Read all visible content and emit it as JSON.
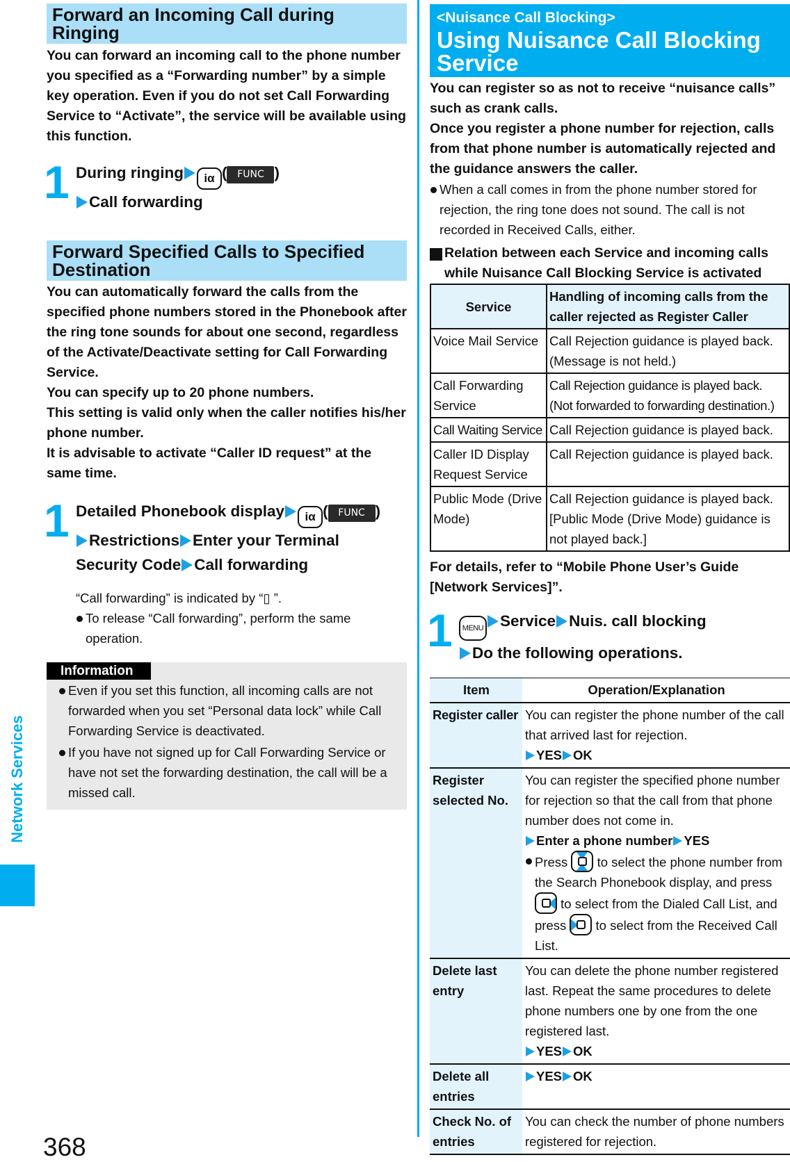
{
  "page": {
    "number": "368",
    "side_tab_label": "Network Services",
    "accent_color": "#00aeef",
    "heading_bg_color": "#aadff7"
  },
  "left": {
    "section1": {
      "title": "Forward an Incoming Call during Ringing",
      "intro": "You can forward an incoming call to the phone number you specified as a “Forwarding number” by a simple key operation. Even if you do not set Call Forwarding Service to “Activate”, the service will be available using this function.",
      "step_number": "1",
      "step_line1_text": "During ringing",
      "key_label": "iα",
      "func_label": "FUNC",
      "step_line2_text": "Call forwarding"
    },
    "section2": {
      "title": "Forward Specified Calls to Specified Destination",
      "paragraphs": [
        "You can automatically forward the calls from the specified phone numbers stored in the Phonebook after the ring tone sounds for about one second, regardless of the Activate/Deactivate setting for Call Forwarding Service.",
        "You can specify up to 20 phone numbers.",
        "This setting is valid only when the caller notifies his/her phone number.",
        "It is advisable to activate “Caller ID request” at the same time."
      ],
      "step_number": "1",
      "step_line1_text": "Detailed Phonebook display",
      "key_label": "iα",
      "func_label": "FUNC",
      "step_line2_a": "Restrictions",
      "step_line2_b": "Enter your Terminal",
      "step_line3_a": "Security Code",
      "step_line3_b": "Call forwarding",
      "note": "“Call forwarding” is indicated by “▯ ”.",
      "bullet": "To release “Call forwarding”, perform the same operation."
    },
    "information": {
      "label": "Information",
      "bullets": [
        "Even if you set this function, all incoming calls are not forwarded when you set “Personal data lock” while Call Forwarding Service is deactivated.",
        "If you have not signed up for Call Forwarding Service or have not set the forwarding destination, the call will be a missed call."
      ]
    }
  },
  "right": {
    "header": {
      "subtitle": "<Nuisance Call Blocking>",
      "title": "Using Nuisance Call Blocking Service"
    },
    "intro_bold": [
      "You can register so as not to receive “nuisance calls” such as crank calls.",
      "Once you register a phone number for rejection, calls from that phone number is automatically rejected and the guidance answers the caller."
    ],
    "intro_bullet": "When a call comes in from the phone number stored for rejection, the ring tone does not sound. The call is not recorded in Received Calls, either.",
    "relation_heading": "Relation between each Service and incoming calls while Nuisance Call Blocking Service is activated",
    "relation_table": {
      "headers": [
        "Service",
        "Handling of incoming calls from the caller rejected as Register Caller"
      ],
      "rows": [
        [
          "Voice Mail Service",
          "Call Rejection guidance is played back. (Message is not held.)"
        ],
        [
          "Call Forwarding Service",
          "Call Rejection guidance is played back. (Not forwarded to forwarding destination.)"
        ],
        [
          "Call Waiting Service",
          "Call Rejection guidance is played back."
        ],
        [
          "Caller ID Display Request Service",
          "Call Rejection guidance is played back."
        ],
        [
          "Public Mode (Drive Mode)",
          "Call Rejection guidance is played back. [Public Mode (Drive Mode) guidance is not played back.]"
        ]
      ]
    },
    "details_ref": "For details, refer to “Mobile Phone User’s Guide [Network Services]”.",
    "step": {
      "number": "1",
      "menu_key": "MENU",
      "line1_a": "Service",
      "line1_b": "Nuis. call blocking",
      "line2": "Do the following operations."
    },
    "ops_table": {
      "headers": [
        "Item",
        "Operation/Explanation"
      ],
      "rows": [
        {
          "item": "Register caller",
          "text": "You can register the phone number of the call that arrived last for rejection.",
          "ops": [
            "YES",
            "OK"
          ]
        },
        {
          "item": "Register selected No.",
          "text": "You can register the specified phone number for rejection so that the call from that phone number does not come in.",
          "ops": [
            "Enter a phone number",
            "YES"
          ],
          "bullet_parts": [
            "Press",
            "to select the phone number from the Search Phonebook display, and press",
            "to select from the Dialed Call List, and press",
            "to select from the Received Call List."
          ]
        },
        {
          "item": "Delete last entry",
          "text": "You can delete the phone number registered last. Repeat the same procedures to delete phone numbers one by one from the one registered last.",
          "ops": [
            "YES",
            "OK"
          ]
        },
        {
          "item": "Delete all entries",
          "text": "",
          "ops": [
            "YES",
            "OK"
          ]
        },
        {
          "item": "Check No. of entries",
          "text": "You can check the number of phone numbers registered for rejection."
        }
      ]
    }
  }
}
